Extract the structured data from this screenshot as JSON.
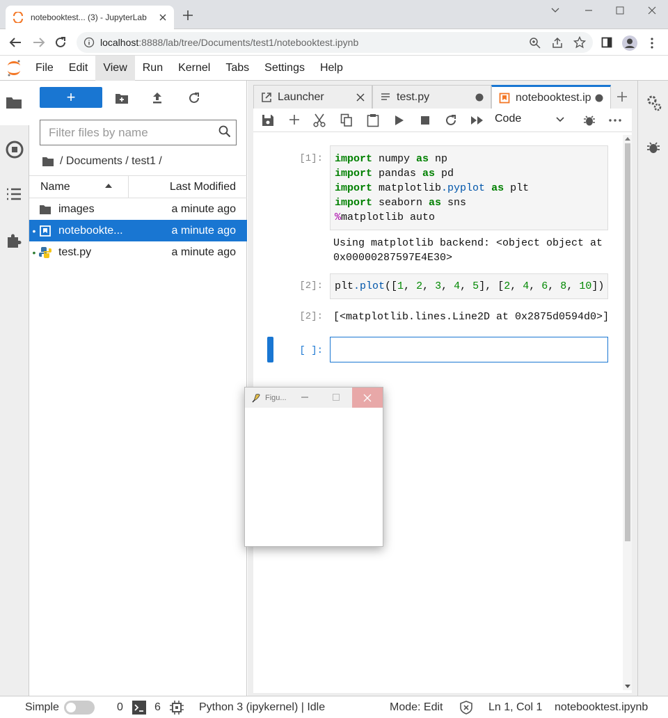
{
  "browser": {
    "tab_title": "notebooktest... (3) - JupyterLab",
    "url_host": "localhost",
    "url_rest": ":8888/lab/tree/Documents/test1/notebooktest.ipynb"
  },
  "menu": [
    "File",
    "Edit",
    "View",
    "Run",
    "Kernel",
    "Tabs",
    "Settings",
    "Help"
  ],
  "file_browser": {
    "filter_placeholder": "Filter files by name",
    "breadcrumb": "/ Documents / test1 /",
    "col_name": "Name",
    "col_modified": "Last Modified",
    "files": [
      {
        "name": "images",
        "modified": "a minute ago",
        "type": "folder",
        "running": false,
        "selected": false
      },
      {
        "name": "notebookte...",
        "modified": "a minute ago",
        "type": "notebook",
        "running": true,
        "selected": true
      },
      {
        "name": "test.py",
        "modified": "a minute ago",
        "type": "python",
        "running": true,
        "selected": false
      }
    ]
  },
  "doc_tabs": [
    {
      "label": "Launcher"
    },
    {
      "label": "test.py"
    },
    {
      "label": "notebooktest.ip"
    }
  ],
  "toolbar": {
    "cell_type": "Code"
  },
  "cells": {
    "c1_prompt": "[1]:",
    "c1_output": "Using matplotlib backend: <object object at\n0x00000287597E4E30>",
    "c2_prompt": "[2]:",
    "c2_out_prompt": "[2]:",
    "c2_output": "[<matplotlib.lines.Line2D at 0x2875d0594d0>]",
    "c3_prompt": "[ ]:"
  },
  "figure_window": {
    "title": "Figu..."
  },
  "status": {
    "mode_label": "Simple",
    "terminals": "0",
    "kernels": "6",
    "kernel": "Python 3 (ipykernel) | Idle",
    "mode": "Mode: Edit",
    "cursor": "Ln 1, Col 1",
    "file": "notebooktest.ipynb"
  }
}
